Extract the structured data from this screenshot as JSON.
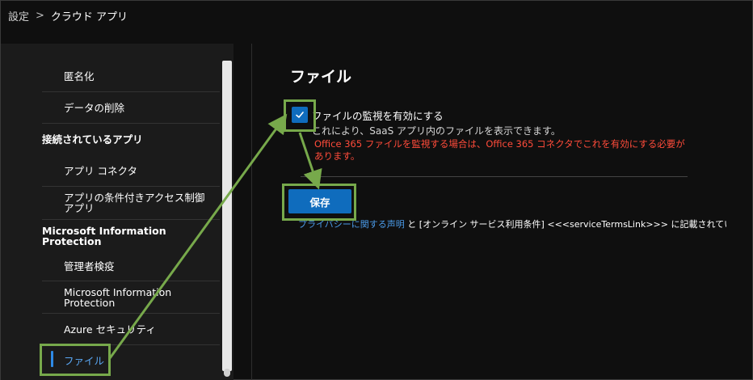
{
  "breadcrumb": {
    "root": "設定",
    "separator": ">",
    "current": "クラウド アプリ"
  },
  "sidebar": {
    "items": [
      {
        "label": "匿名化",
        "type": "sub"
      },
      {
        "label": "データの削除",
        "type": "sub"
      },
      {
        "label": "接続されているアプリ",
        "type": "header"
      },
      {
        "label": "アプリ コネクタ",
        "type": "sub"
      },
      {
        "label": "アプリの条件付きアクセス制御アプリ",
        "type": "sub"
      },
      {
        "label": "Microsoft Information Protection",
        "type": "header"
      },
      {
        "label": "管理者検疫",
        "type": "sub"
      },
      {
        "label": "Microsoft Information Protection",
        "type": "sub"
      },
      {
        "label": "Azure セキュリティ",
        "type": "sub"
      },
      {
        "label": "ファイル",
        "type": "sub",
        "active": true
      }
    ]
  },
  "main": {
    "title": "ファイル",
    "checkbox": {
      "label": "ファイルの監視を有効にする",
      "checked": true,
      "description": "これにより、SaaS アプリ内のファイルを表示できます。",
      "warning": "Office 365 ファイルを監視する場合は、Office 365 コネクタでこれを有効にする必要があります。"
    },
    "save_label": "保存",
    "footer": {
      "privacy_link": "プライバシーに関する声明",
      "text": " と [オンライン サービス利用条件] <<<serviceTermsLink>>> に記載されているよう"
    }
  },
  "colors": {
    "accent": "#0f6cbd",
    "warning": "#ff4b3a",
    "annotation": "#77a94b",
    "link": "#4a9ae8"
  }
}
